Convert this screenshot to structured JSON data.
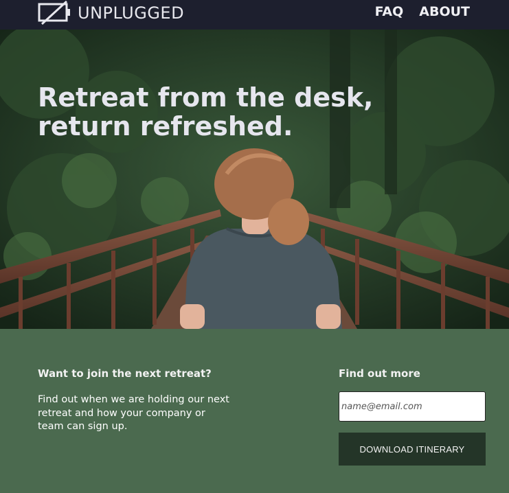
{
  "brand": {
    "name": "UNPLUGGED",
    "logo_icon": "battery-unplugged-icon"
  },
  "nav": {
    "items": [
      {
        "label": "FAQ"
      },
      {
        "label": "ABOUT"
      }
    ]
  },
  "hero": {
    "title": "Retreat from the desk, return refreshed.",
    "image": "woman-on-forest-bridge-photo"
  },
  "join": {
    "heading": "Want to join the next retreat?",
    "body": "Find out when we are holding our next retreat and how your company or team can sign up."
  },
  "signup": {
    "heading": "Find out more",
    "email_placeholder": "name@email.com",
    "email_value": "",
    "button_label": "DOWNLOAD ITINERARY"
  },
  "colors": {
    "topbar": "#1d1f2e",
    "info_bg": "#4b6a4f",
    "button_bg": "#243528"
  }
}
